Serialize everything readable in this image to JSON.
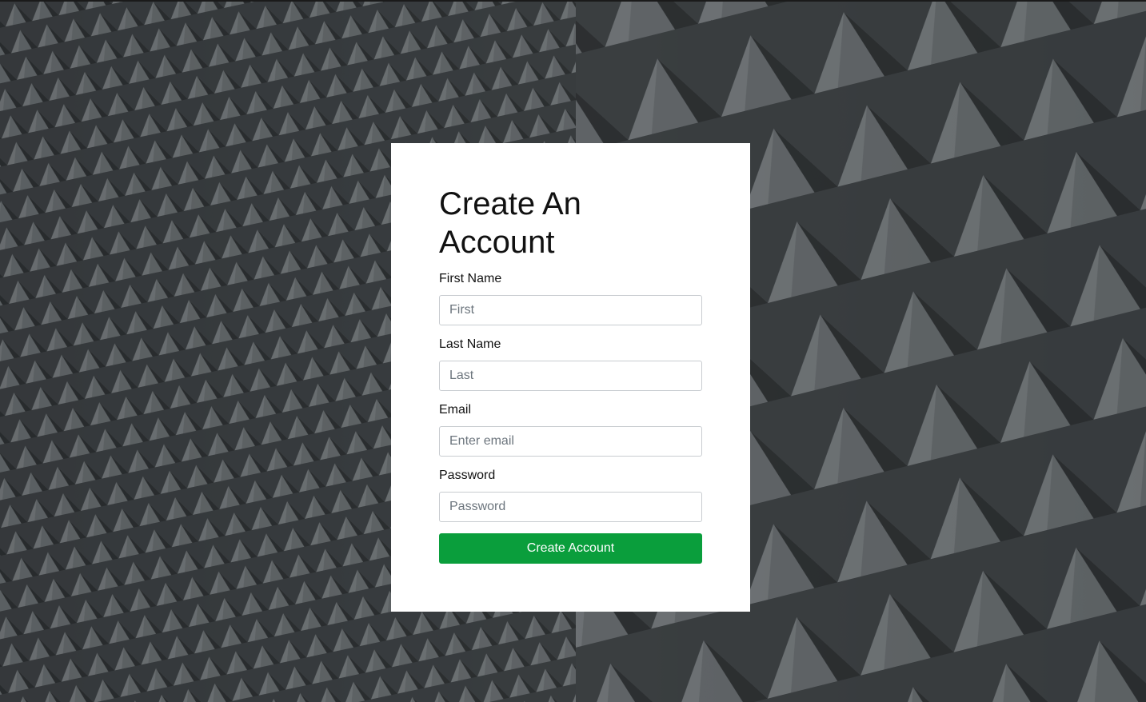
{
  "form": {
    "title": "Create An Account",
    "fields": [
      {
        "label": "First Name",
        "placeholder": "First",
        "value": ""
      },
      {
        "label": "Last Name",
        "placeholder": "Last",
        "value": ""
      },
      {
        "label": "Email",
        "placeholder": "Enter email",
        "value": ""
      },
      {
        "label": "Password",
        "placeholder": "Password",
        "value": ""
      }
    ],
    "submit_label": "Create Account"
  },
  "colors": {
    "accent": "#0a9e3c",
    "card": "#ffffff",
    "background": "#4a4d50"
  },
  "background_image": "acoustic-foam-pattern"
}
